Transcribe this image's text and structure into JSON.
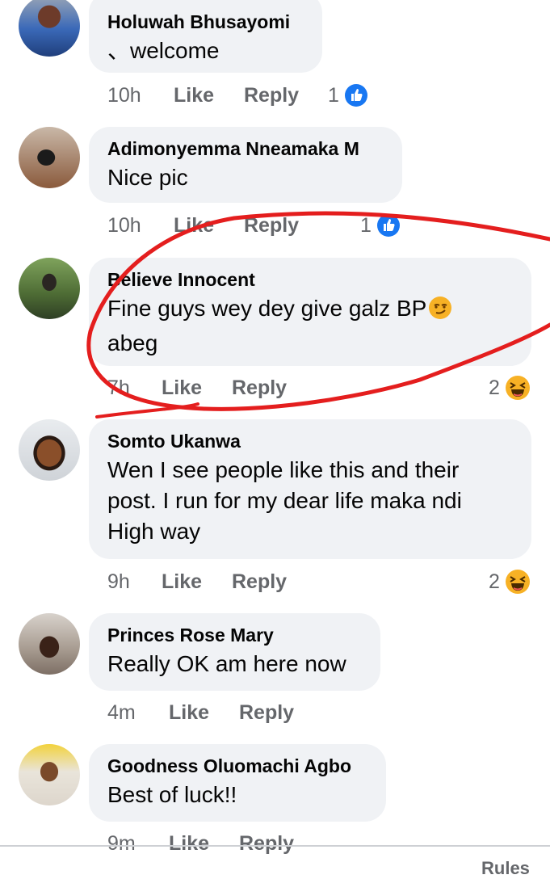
{
  "comments": [
    {
      "name": "Holuwah Bhusayomi",
      "text": "、welcome",
      "time": "10h",
      "like": "Like",
      "reply": "Reply",
      "reaction_count": "1",
      "reaction_icon": "like-icon"
    },
    {
      "name": "Adimonyemma Nneamaka M",
      "text": "Nice pic",
      "time": "10h",
      "like": "Like",
      "reply": "Reply",
      "reaction_count": "1",
      "reaction_icon": "like-icon"
    },
    {
      "name": "Believe Innocent",
      "text_line1": "Fine guys wey dey give galz BP",
      "text_line2": "abeg",
      "time": "7h",
      "like": "Like",
      "reply": "Reply",
      "reaction_count": "2",
      "reaction_icon": "haha-icon"
    },
    {
      "name": "Somto Ukanwa",
      "text_line1": "Wen I see people like this and their",
      "text_line2": "post. I run for my dear life maka ndi",
      "text_line3": "High way",
      "time": "9h",
      "like": "Like",
      "reply": "Reply",
      "reaction_count": "2",
      "reaction_icon": "haha-icon"
    },
    {
      "name": "Princes Rose Mary",
      "text": "Really OK am here now",
      "time": "4m",
      "like": "Like",
      "reply": "Reply"
    },
    {
      "name": "Goodness Oluomachi Agbo",
      "text": "Best of luck!!",
      "time": "9m",
      "like": "Like",
      "reply": "Reply"
    }
  ],
  "footer": {
    "rules_label": "Rules"
  },
  "colors": {
    "like_blue": "#1877f2",
    "haha_yellow": "#f7b125",
    "annotation_red": "#e41e1e"
  }
}
